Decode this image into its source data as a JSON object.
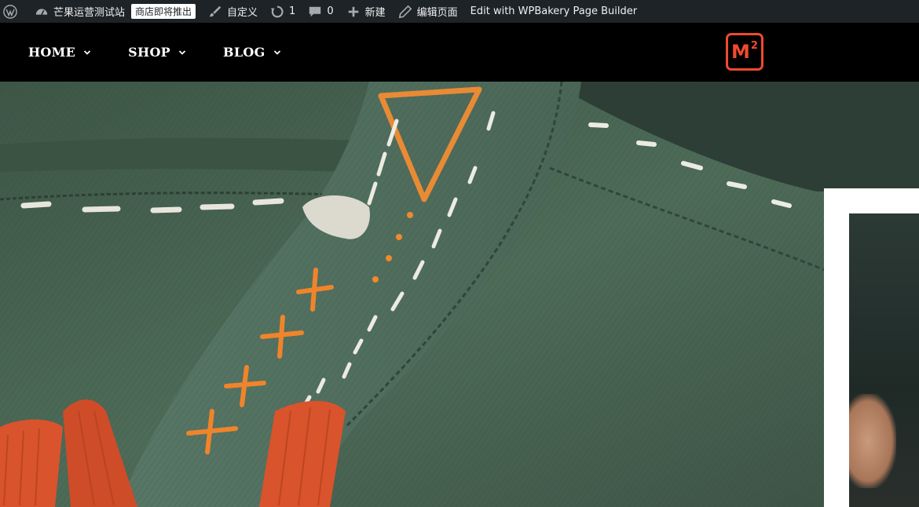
{
  "adminbar": {
    "site_name": "芒果运营测试站",
    "site_badge": "商店即将推出",
    "customize": "自定义",
    "updates_count": "1",
    "comments_count": "0",
    "new_label": "新建",
    "edit_page": "编辑页面",
    "builder": "Edit with WPBakery Page Builder"
  },
  "nav": {
    "items": [
      {
        "label": "HOME"
      },
      {
        "label": "SHOP"
      },
      {
        "label": "BLOG"
      }
    ]
  },
  "logo": {
    "text": "M",
    "superscript": "2",
    "color": "#ef4a2e"
  },
  "colors": {
    "adminbar_bg": "#1d2327",
    "header_bg": "#000000",
    "fabric_green": "#4d6a57",
    "stitch_orange": "#f0842a",
    "patch_red": "#d9532c"
  }
}
